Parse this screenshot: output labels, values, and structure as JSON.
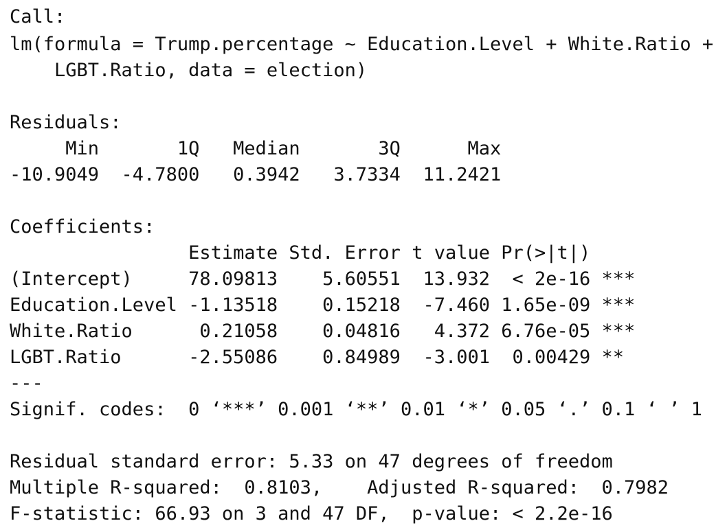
{
  "call": {
    "label": "Call:",
    "line1": "lm(formula = Trump.percentage ~ Education.Level + White.Ratio +",
    "line2": "    LGBT.Ratio, data = election)"
  },
  "residuals": {
    "label": "Residuals:",
    "header": "     Min       1Q   Median       3Q      Max",
    "values": "-10.9049  -4.7800   0.3942   3.7334  11.2421"
  },
  "coefficients": {
    "label": "Coefficients:",
    "header": "                Estimate Std. Error t value Pr(>|t|)",
    "rows": [
      "(Intercept)     78.09813    5.60551  13.932  < 2e-16 ***",
      "Education.Level -1.13518    0.15218  -7.460 1.65e-09 ***",
      "White.Ratio      0.21058    0.04816   4.372 6.76e-05 ***",
      "LGBT.Ratio      -2.55086    0.84989  -3.001  0.00429 **"
    ],
    "separator": "---",
    "signif_codes": "Signif. codes:  0 ‘***’ 0.001 ‘**’ 0.01 ‘*’ 0.05 ‘.’ 0.1 ‘ ’ 1"
  },
  "summary": {
    "rse": "Residual standard error: 5.33 on 47 degrees of freedom",
    "r_squared": "Multiple R-squared:  0.8103,\tAdjusted R-squared:  0.7982",
    "f_statistic": "F-statistic: 66.93 on 3 and 47 DF,  p-value: < 2.2e-16"
  }
}
